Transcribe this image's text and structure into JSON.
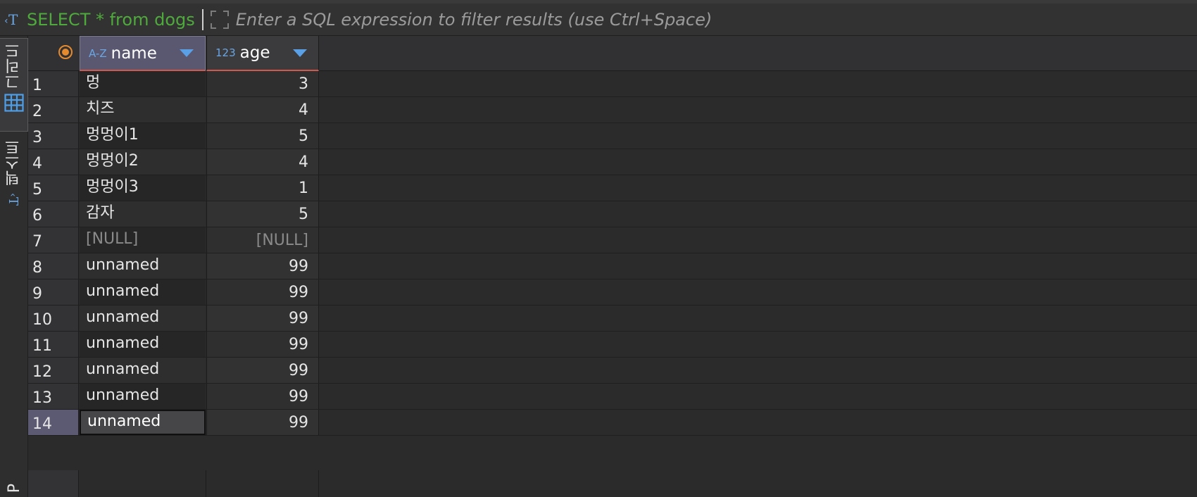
{
  "filter_bar": {
    "query": "SELECT * from dogs",
    "filter_placeholder": "Enter a SQL expression to filter results (use Ctrl+Space)"
  },
  "side_tabs": {
    "grid_label": "그리드",
    "text_label": "텍스트",
    "extra_label": "P"
  },
  "columns": [
    {
      "type_tag": "A-Z",
      "title": "name"
    },
    {
      "type_tag": "123",
      "title": "age"
    }
  ],
  "rows": [
    {
      "num": "1",
      "name": "멍",
      "age": "3"
    },
    {
      "num": "2",
      "name": "치즈",
      "age": "4"
    },
    {
      "num": "3",
      "name": "멍멍이1",
      "age": "5"
    },
    {
      "num": "4",
      "name": "멍멍이2",
      "age": "4"
    },
    {
      "num": "5",
      "name": "멍멍이3",
      "age": "1"
    },
    {
      "num": "6",
      "name": "감자",
      "age": "5"
    },
    {
      "num": "7",
      "name": "[NULL]",
      "age": "[NULL]"
    },
    {
      "num": "8",
      "name": "unnamed",
      "age": "99"
    },
    {
      "num": "9",
      "name": "unnamed",
      "age": "99"
    },
    {
      "num": "10",
      "name": "unnamed",
      "age": "99"
    },
    {
      "num": "11",
      "name": "unnamed",
      "age": "99"
    },
    {
      "num": "12",
      "name": "unnamed",
      "age": "99"
    },
    {
      "num": "13",
      "name": "unnamed",
      "age": "99"
    },
    {
      "num": "14",
      "name": "unnamed",
      "age": "99"
    }
  ],
  "selected_row": 14,
  "colors": {
    "sql_text": "#4faa3c",
    "accent_blue": "#6aa6e3",
    "header_selected": "#5a5870",
    "sort_underline": "#d0594f",
    "row_indicator": "#e58a2d"
  },
  "icons": {
    "filter_icon": "sql-filter-icon",
    "expand_icon": "expand-icon",
    "row_indicator_icon": "radio-target-icon",
    "grid_icon": "grid-icon",
    "text_icon": "text-mode-icon"
  }
}
